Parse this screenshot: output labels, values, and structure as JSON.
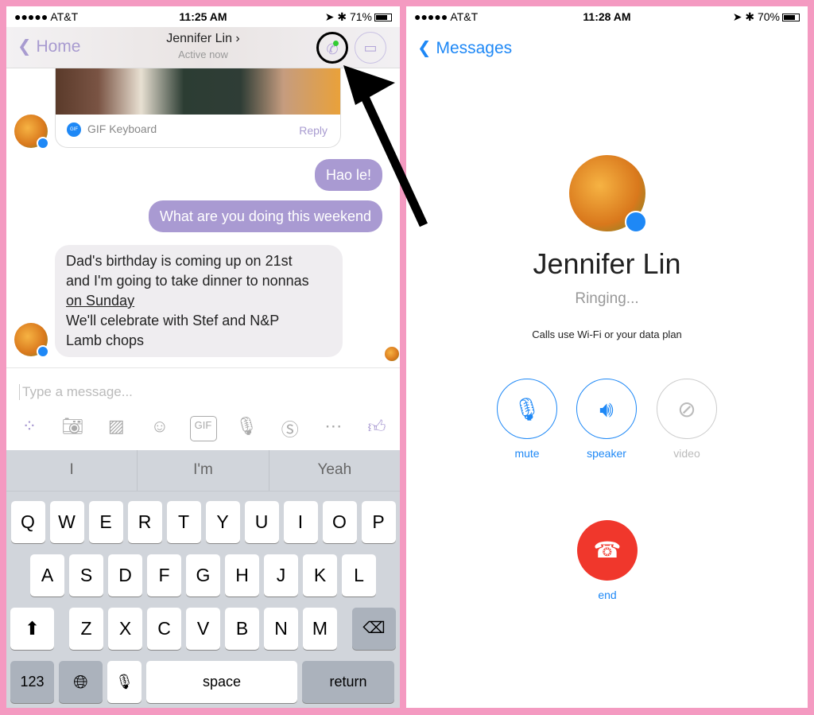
{
  "left": {
    "status": {
      "carrier": "●●●●● AT&T",
      "time": "11:25 AM",
      "battery": "71%",
      "battery_level": 0.71
    },
    "nav": {
      "back": "Home",
      "title": "Jennifer Lin ›",
      "subtitle": "Active now"
    },
    "gif": {
      "source": "GIF Keyboard",
      "badge": "GIF",
      "reply": "Reply"
    },
    "messages": [
      {
        "dir": "out",
        "text": "Hao le!"
      },
      {
        "dir": "out",
        "text": "What are you doing this weekend"
      },
      {
        "dir": "in",
        "lines": [
          "Dad's birthday is coming up on 21st",
          "and I'm going to take dinner to nonnas",
          "on Sunday",
          "We'll celebrate with Stef and N&P",
          "Lamb chops"
        ]
      }
    ],
    "input_placeholder": "Type a message...",
    "toolbar": [
      "apps-icon",
      "camera-icon",
      "photos-icon",
      "emoji-icon",
      "gif-icon",
      "mic-icon",
      "payment-icon",
      "more-icon",
      "thumbs-up-icon"
    ],
    "gif_tool": "GIF",
    "suggestions": [
      "I",
      "I'm",
      "Yeah"
    ],
    "keyboard": {
      "row1": [
        "Q",
        "W",
        "E",
        "R",
        "T",
        "Y",
        "U",
        "I",
        "O",
        "P"
      ],
      "row2": [
        "A",
        "S",
        "D",
        "F",
        "G",
        "H",
        "J",
        "K",
        "L"
      ],
      "row3": [
        "Z",
        "X",
        "C",
        "V",
        "B",
        "N",
        "M"
      ],
      "num": "123",
      "space": "space",
      "return": "return"
    }
  },
  "right": {
    "status": {
      "carrier": "●●●●● AT&T",
      "time": "11:28 AM",
      "battery": "70%",
      "battery_level": 0.7
    },
    "back": "Messages",
    "name": "Jennifer Lin",
    "state": "Ringing...",
    "note": "Calls use Wi-Fi or your data plan",
    "buttons": [
      {
        "label": "mute"
      },
      {
        "label": "speaker"
      },
      {
        "label": "video"
      }
    ],
    "end": "end"
  },
  "colors": {
    "accent_purple": "#a99ad2",
    "messenger_blue": "#1e88f6",
    "end_red": "#f0372c",
    "border_pink": "#f49ac1"
  }
}
